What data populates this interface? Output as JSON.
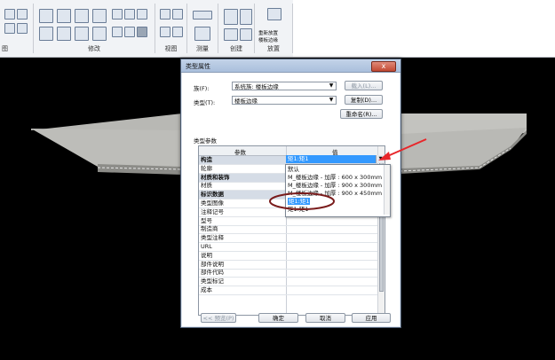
{
  "ribbon": {
    "panel_labels": [
      "图",
      "修改",
      "视图",
      "测量",
      "创建",
      "放置"
    ],
    "extra_label_1": "重新放置",
    "extra_label_2": "楼板边缘"
  },
  "dialog": {
    "title": "类型属性",
    "close_glyph": "x",
    "family_label": "族(F):",
    "family_value": "系统族: 楼板边缘",
    "type_label": "类型(T):",
    "type_value": "楼板边缘",
    "load_button": "载入(L)...",
    "duplicate_button": "复制(D)...",
    "rename_button": "重命名(R)...",
    "type_params_label": "类型参数",
    "col_param": "参数",
    "col_value": "值",
    "collapse_glyph": "≈",
    "rows": [
      {
        "param": "构造",
        "category": true
      },
      {
        "param": "轮廓",
        "category": false
      },
      {
        "param": "材质和装饰",
        "category": true
      },
      {
        "param": "材质",
        "category": false
      },
      {
        "param": "标识数据",
        "category": true
      },
      {
        "param": "类型图像",
        "category": false
      },
      {
        "param": "注释记号",
        "category": false
      },
      {
        "param": "型号",
        "category": false
      },
      {
        "param": "制造商",
        "category": false
      },
      {
        "param": "类型注释",
        "category": false
      },
      {
        "param": "URL",
        "category": false
      },
      {
        "param": "说明",
        "category": false
      },
      {
        "param": "部件说明",
        "category": false
      },
      {
        "param": "部件代码",
        "category": false
      },
      {
        "param": "类型标记",
        "category": false
      },
      {
        "param": "成本",
        "category": false
      }
    ],
    "profile_value": "矩1:矩1",
    "dropdown_items": [
      "默认",
      "M_楼板边缘 - 加厚 : 600 x 300mm",
      "M_楼板边缘 - 加厚 : 900 x 300mm",
      "M_楼板边缘 - 加厚 : 900 x 450mm",
      "矩1:矩1",
      "矩1:矩1"
    ],
    "dropdown_selected": 4,
    "preview_button": "<< 预览(P)",
    "ok_button": "确定",
    "cancel_button": "取消",
    "apply_button": "应用"
  },
  "colors": {
    "annotation_red": "#e8262a",
    "annotation_ellipse": "#7a1c1c",
    "selection_blue": "#3399ff"
  }
}
